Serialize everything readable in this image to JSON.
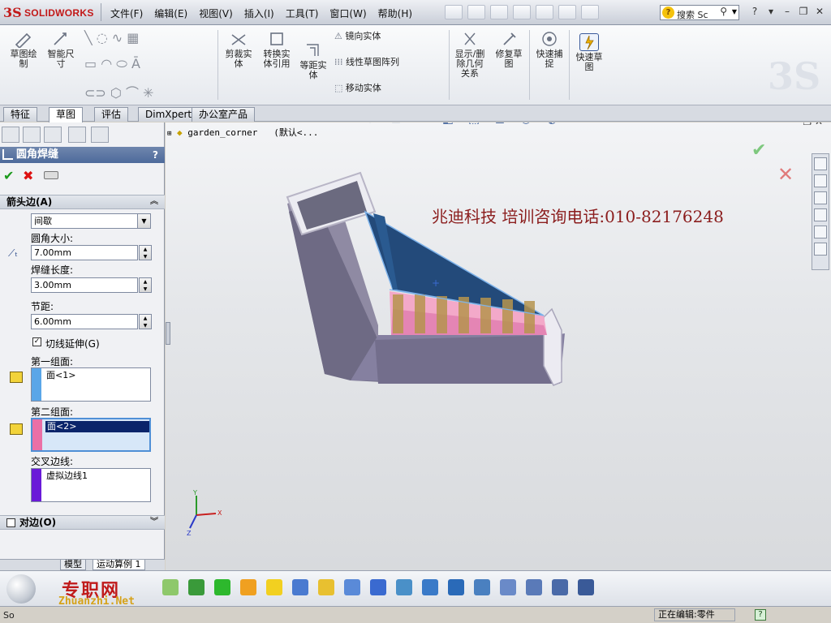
{
  "app": {
    "logo_ds": "3S",
    "logo_text": "SOLIDWORKS"
  },
  "menus": [
    "文件(F)",
    "编辑(E)",
    "视图(V)",
    "插入(I)",
    "工具(T)",
    "窗口(W)",
    "帮助(H)"
  ],
  "search": {
    "icon": "help-icon",
    "text": "搜索 Sc",
    "search_icon": "magnifier-icon"
  },
  "window_controls": [
    "?",
    "▾",
    "–",
    "❐",
    "✕"
  ],
  "command_manager": {
    "tools": [
      {
        "label": "草图绘\n制",
        "icon": "sketch-icon"
      },
      {
        "label": "智能尺\n寸",
        "icon": "smart-dimension-icon"
      },
      {
        "label": "剪裁实\n体",
        "icon": "trim-icon"
      },
      {
        "label": "转换实\n体引用",
        "icon": "convert-entities-icon"
      },
      {
        "label": "等距实\n体",
        "icon": "offset-entities-icon"
      },
      {
        "label": "显示/删\n除几何\n关系",
        "icon": "relations-icon"
      },
      {
        "label": "修复草\n图",
        "icon": "repair-sketch-icon"
      },
      {
        "label": "快速捕\n捉",
        "icon": "quick-snap-icon"
      },
      {
        "label": "快速草\n图",
        "icon": "rapid-sketch-icon"
      }
    ],
    "small_tools": [
      "镜向实体",
      "线性草图阵列",
      "移动实体"
    ]
  },
  "tabs": [
    "特征",
    "草图",
    "评估",
    "DimXpert",
    "办公室产品"
  ],
  "active_tab": "草图",
  "property_manager": {
    "title": "圆角焊缝",
    "help": "?",
    "section_arrow": "箭头边(A)",
    "weld_type": "间歇",
    "fillet_size_label": "圆角大小:",
    "fillet_size": "7.00mm",
    "weld_length_label": "焊缝长度:",
    "weld_length": "3.00mm",
    "pitch_label": "节距:",
    "pitch": "6.00mm",
    "tangent_label": "切线延伸(G)",
    "first_face_label": "第一组面:",
    "first_face": "面<1>",
    "second_face_label": "第二组面:",
    "second_face": "面<2>",
    "intersect_label": "交叉边线:",
    "intersect": "虚拟边线1",
    "other_side": "对边(O)"
  },
  "bottom_tabs": [
    "模型",
    "运动算例 1"
  ],
  "graphics": {
    "tree_item": "garden_corner",
    "tree_config": "(默认<...",
    "watermark": "兆迪科技    培训咨询电话:010-82176248",
    "triad_x": "X",
    "triad_y": "Y",
    "triad_z": "Z"
  },
  "brand": {
    "cn": "专职网",
    "en": "Zhuanzhi.Net"
  },
  "status": {
    "left": "So",
    "editing": "正在编辑:零件",
    "help": "?"
  }
}
